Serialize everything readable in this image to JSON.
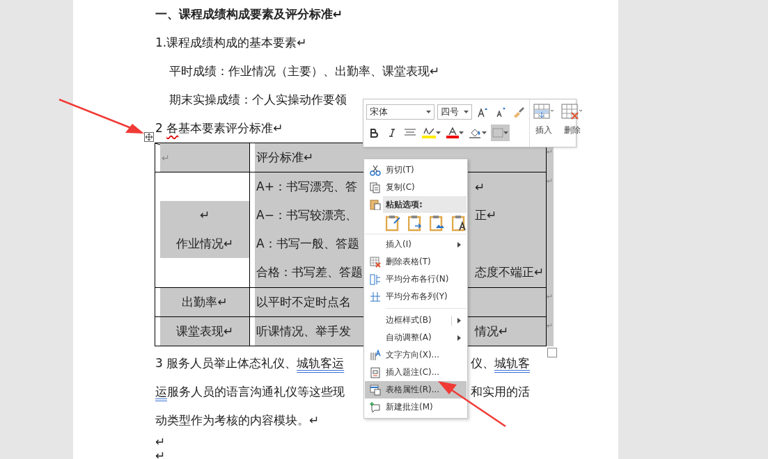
{
  "document": {
    "lines": [
      {
        "kind": "heading",
        "left": [
          {
            "text": "一、课程成绩构成要素及评分标准↵"
          }
        ]
      },
      {
        "kind": "body",
        "left": [
          {
            "text": "1.课程成绩构成的基本要素↵"
          }
        ]
      },
      {
        "kind": "indent",
        "left": [
          {
            "text": "平时成绩：作业情况（主要）、出勤率、课堂表现↵"
          }
        ]
      },
      {
        "kind": "indent",
        "left": [
          {
            "text": "期末实操成绩：个人实操动作要领"
          }
        ]
      },
      {
        "kind": "body",
        "left": [
          {
            "text": "2 "
          },
          {
            "text": "各",
            "spelling_error": true
          },
          {
            "text": "基本要素评分标准↵"
          }
        ]
      }
    ],
    "table": {
      "corner": "↵",
      "header": "评分标准↵",
      "header_end": "↵",
      "rows": [
        {
          "label_lines": [
            "↵",
            "作业情况↵"
          ],
          "end": "↵",
          "lines": [
            {
              "left": "A+：书写漂亮、答",
              "right": "↵"
            },
            {
              "left": "A−：书写较漂亮、",
              "right": "正↵"
            },
            {
              "left": "A：书写一般、答题"
            },
            {
              "left": "合格：书写差、答题",
              "right": "态度不端正↵"
            }
          ]
        },
        {
          "label_lines": [
            "出勤率↵"
          ],
          "end": "↵",
          "lines": [
            {
              "left": "以平时不定时点名"
            }
          ]
        },
        {
          "label_lines": [
            "课堂表现↵"
          ],
          "end": "↵",
          "lines": [
            {
              "left": "听课情况、举手发",
              "right": "情况↵"
            }
          ]
        }
      ]
    },
    "after": [
      {
        "kind": "body",
        "left": [
          {
            "text": "3 服务人员举止体态礼仪、"
          },
          {
            "text": "城轨客运",
            "grammar_error": true
          }
        ],
        "right": [
          {
            "text": "仪、"
          },
          {
            "text": "城轨客",
            "grammar_error": true
          }
        ]
      },
      {
        "kind": "body",
        "left": [
          {
            "text": "运",
            "grammar_error": true
          },
          {
            "text": "服务人员的语言沟通礼仪等这些现"
          }
        ],
        "right": [
          {
            "text": "和实用的活"
          }
        ]
      },
      {
        "kind": "body",
        "left": [
          {
            "text": "动类型作为考核的内容模块。↵"
          }
        ]
      },
      {
        "kind": "empty",
        "left": [
          {
            "text": "↵"
          }
        ]
      },
      {
        "kind": "empty",
        "left": [
          {
            "text": "↵"
          }
        ]
      }
    ]
  },
  "mini_toolbar": {
    "font": "宋体",
    "size": "四号",
    "insert": "插入",
    "delete": "删除"
  },
  "context_menu": [
    {
      "kind": "item",
      "label": "剪切(T)",
      "submenu": false,
      "selected": false
    },
    {
      "kind": "item",
      "label": "复制(C)",
      "submenu": false,
      "selected": false
    },
    {
      "kind": "header",
      "label": "粘贴选项:"
    },
    {
      "kind": "paste"
    },
    {
      "kind": "item",
      "label": "插入(I)",
      "submenu": true,
      "selected": false
    },
    {
      "kind": "item",
      "label": "删除表格(T)",
      "submenu": false,
      "selected": false
    },
    {
      "kind": "item",
      "label": "平均分布各行(N)",
      "submenu": false,
      "selected": false
    },
    {
      "kind": "item",
      "label": "平均分布各列(Y)",
      "submenu": false,
      "selected": false
    },
    {
      "kind": "separator"
    },
    {
      "kind": "item",
      "label": "边框样式(B)",
      "submenu": true,
      "selected": false
    },
    {
      "kind": "item",
      "label": "自动调整(A)",
      "submenu": true,
      "selected": false
    },
    {
      "kind": "item",
      "label": "文字方向(X)...",
      "submenu": false,
      "selected": false
    },
    {
      "kind": "item",
      "label": "插入题注(C)...",
      "submenu": false,
      "selected": false
    },
    {
      "kind": "item",
      "label": "表格属性(R)...",
      "submenu": false,
      "selected": true
    },
    {
      "kind": "item",
      "label": "新建批注(M)",
      "submenu": false,
      "selected": false
    }
  ]
}
